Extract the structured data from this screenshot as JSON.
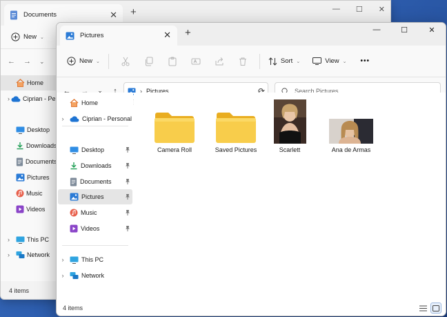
{
  "colors": {
    "accent": "#0067c0",
    "folder_yellow": "#f5c52f",
    "selection": "#e5e5e5",
    "desktop_blue": "#2e5fb0"
  },
  "back_window": {
    "tab_title": "Documents",
    "toolbar": {
      "new_label": "New"
    },
    "nav_items": [
      {
        "label": "Home",
        "icon": "home-icon",
        "selected": true,
        "expandable": false
      },
      {
        "label": "Ciprian - Personal",
        "icon": "onedrive-cloud-icon",
        "selected": false,
        "expandable": true
      },
      {
        "label": "Desktop",
        "icon": "desktop-icon",
        "selected": false,
        "expandable": false
      },
      {
        "label": "Downloads",
        "icon": "downloads-icon",
        "selected": false,
        "expandable": false
      },
      {
        "label": "Documents",
        "icon": "documents-icon",
        "selected": false,
        "expandable": false
      },
      {
        "label": "Pictures",
        "icon": "pictures-icon",
        "selected": false,
        "expandable": false
      },
      {
        "label": "Music",
        "icon": "music-icon",
        "selected": false,
        "expandable": false
      },
      {
        "label": "Videos",
        "icon": "videos-icon",
        "selected": false,
        "expandable": false
      },
      {
        "label": "This PC",
        "icon": "this-pc-icon",
        "selected": false,
        "expandable": true
      },
      {
        "label": "Network",
        "icon": "network-icon",
        "selected": false,
        "expandable": true
      }
    ],
    "status": "4 items"
  },
  "window": {
    "tab_title": "Pictures",
    "toolbar": {
      "new_label": "New",
      "sort_label": "Sort",
      "view_label": "View",
      "more_label": "•••"
    },
    "address": {
      "location": "Pictures"
    },
    "search": {
      "placeholder": "Search Pictures"
    },
    "nav_items": [
      {
        "label": "Home",
        "icon": "home-icon",
        "selected": false,
        "expandable": false,
        "pinned": false
      },
      {
        "label": "Ciprian - Personal",
        "icon": "onedrive-cloud-icon",
        "selected": false,
        "expandable": true,
        "pinned": false
      },
      {
        "label": "Desktop",
        "icon": "desktop-icon",
        "selected": false,
        "expandable": false,
        "pinned": true
      },
      {
        "label": "Downloads",
        "icon": "downloads-icon",
        "selected": false,
        "expandable": false,
        "pinned": true
      },
      {
        "label": "Documents",
        "icon": "documents-icon",
        "selected": false,
        "expandable": false,
        "pinned": true
      },
      {
        "label": "Pictures",
        "icon": "pictures-icon",
        "selected": true,
        "expandable": false,
        "pinned": true
      },
      {
        "label": "Music",
        "icon": "music-icon",
        "selected": false,
        "expandable": false,
        "pinned": true
      },
      {
        "label": "Videos",
        "icon": "videos-icon",
        "selected": false,
        "expandable": false,
        "pinned": true
      },
      {
        "label": "This PC",
        "icon": "this-pc-icon",
        "selected": false,
        "expandable": true,
        "pinned": false
      },
      {
        "label": "Network",
        "icon": "network-icon",
        "selected": false,
        "expandable": true,
        "pinned": false
      }
    ],
    "files": [
      {
        "name": "Camera Roll",
        "type": "folder"
      },
      {
        "name": "Saved Pictures",
        "type": "folder"
      },
      {
        "name": "Scarlett",
        "type": "image"
      },
      {
        "name": "Ana de Armas",
        "type": "image"
      }
    ],
    "status": "4 items"
  }
}
